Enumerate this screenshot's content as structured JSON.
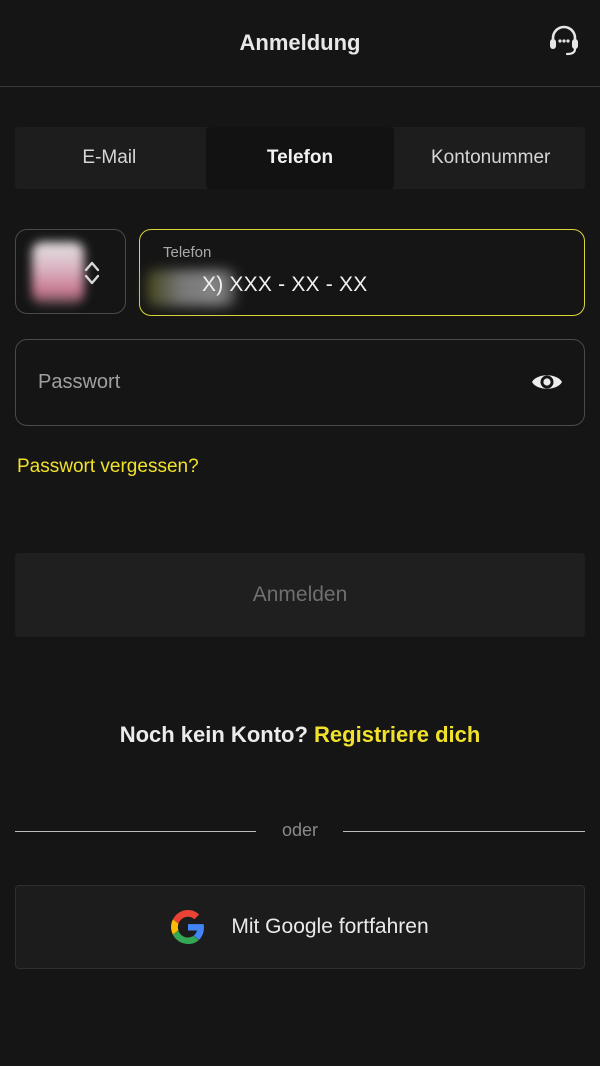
{
  "header": {
    "title": "Anmeldung",
    "support_icon": "headset-icon"
  },
  "tabs": [
    {
      "label": "E-Mail",
      "active": false
    },
    {
      "label": "Telefon",
      "active": true
    },
    {
      "label": "Kontonummer",
      "active": false
    }
  ],
  "phone": {
    "country_icon": "up-down-chevron-icon",
    "label": "Telefon",
    "value": "X) XXX - XX - XX"
  },
  "password": {
    "placeholder": "Passwort",
    "toggle_icon": "eye-icon"
  },
  "forgot_password": "Passwort vergessen?",
  "login_button": "Anmelden",
  "register": {
    "prompt": "Noch kein Konto?",
    "link": "Registriere dich"
  },
  "divider_text": "oder",
  "google_button": {
    "label": "Mit Google fortfahren",
    "icon": "google-icon"
  },
  "colors": {
    "background": "#151515",
    "accent_yellow": "#f1e12a",
    "focus_border": "#d9d63a"
  }
}
